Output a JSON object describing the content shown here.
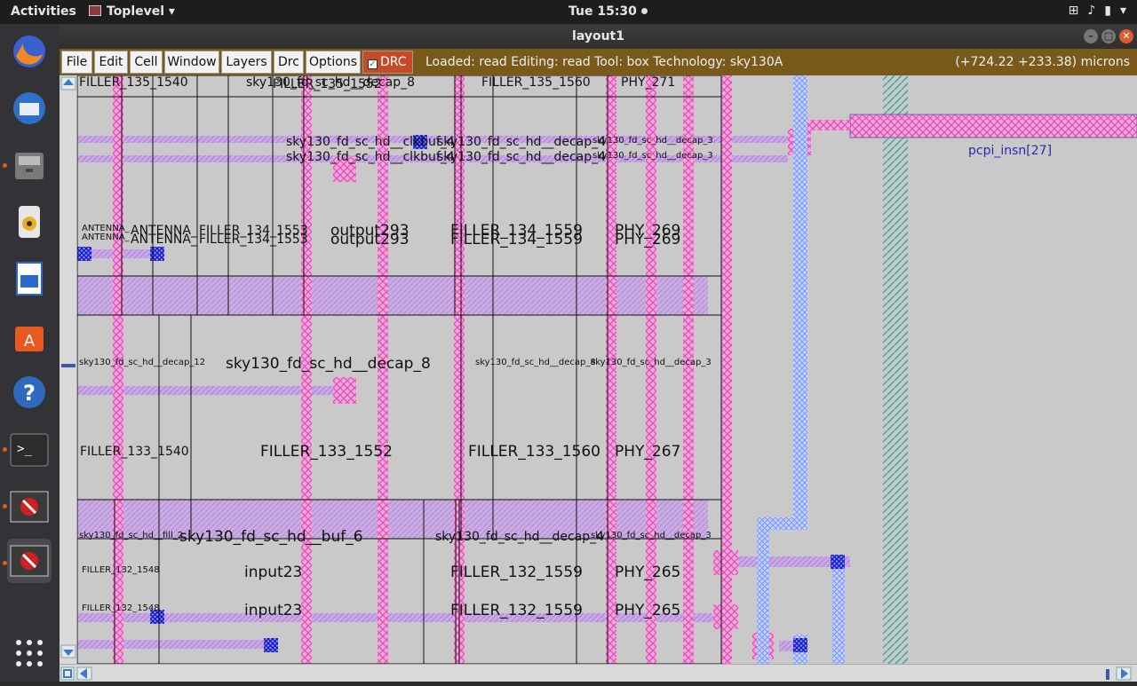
{
  "topbar": {
    "activities": "Activities",
    "app_name": "Toplevel",
    "clock": "Tue 15:30"
  },
  "window": {
    "title": "layout1"
  },
  "menu": {
    "file": "File",
    "edit": "Edit",
    "cell": "Cell",
    "window": "Window",
    "layers": "Layers",
    "drc": "Drc",
    "options": "Options",
    "drc_toggle": "DRC"
  },
  "status": {
    "text": "Loaded: read Editing: read Tool: box  Technology: sky130A",
    "coords": "(+724.22 +233.38) microns"
  },
  "layout": {
    "pin_label": "pcpi_insn[27]",
    "cells": [
      {
        "t": "FILLER_135_1540"
      },
      {
        "t": "sky130_fd_sc_hd__decap_8"
      },
      {
        "t": "FILLER_135_1552"
      },
      {
        "t": "FILLER_135_1560"
      },
      {
        "t": "PHY_271"
      },
      {
        "t": "sky130_fd_sc_hd__clkbuf_4"
      },
      {
        "t": "sky130_fd_sc_hd__decap_4"
      },
      {
        "t": "sky130_fd_sc_hd__decap_3"
      },
      {
        "t": "sky130_fd_sc_hd__clkbuf_4"
      },
      {
        "t": "sky130_fd_sc_hd__decap_4"
      },
      {
        "t": "sky130_fd_sc_hd__decap_3"
      },
      {
        "t": "ANTENNA_"
      },
      {
        "t": "ANTENNA_"
      },
      {
        "t": "FILLER_134_1553"
      },
      {
        "t": "output293"
      },
      {
        "t": "FILLER_134_1559"
      },
      {
        "t": "PHY_269"
      },
      {
        "t": "ANTENNA_"
      },
      {
        "t": "ANTENNA_"
      },
      {
        "t": "FILLER_134_1553"
      },
      {
        "t": "output293"
      },
      {
        "t": "FILLER_134_1559"
      },
      {
        "t": "PHY_269"
      },
      {
        "t": "sky130_fd_sc_hd__decap_12"
      },
      {
        "t": "sky130_fd_sc_hd__decap_8"
      },
      {
        "t": "sky130_fd_sc_hd__decap_8"
      },
      {
        "t": "sky130_fd_sc_hd__decap_3"
      },
      {
        "t": "FILLER_133_1540"
      },
      {
        "t": "FILLER_133_1552"
      },
      {
        "t": "FILLER_133_1560"
      },
      {
        "t": "PHY_267"
      },
      {
        "t": "sky130_fd_sc_hd__fill_2"
      },
      {
        "t": "sky130_fd_sc_hd__buf_6"
      },
      {
        "t": "sky130_fd_sc_hd__decap_4"
      },
      {
        "t": "sky130_fd_sc_hd__decap_3"
      },
      {
        "t": "FILLER_132_1548"
      },
      {
        "t": "input23"
      },
      {
        "t": "FILLER_132_1559"
      },
      {
        "t": "PHY_265"
      },
      {
        "t": "FILLER_132_1548"
      },
      {
        "t": "input23"
      },
      {
        "t": "FILLER_132_1559"
      },
      {
        "t": "PHY_265"
      }
    ]
  },
  "colors": {
    "menubar": "#7a5a1a",
    "drc_button": "#c44a2a",
    "metal1": "#e070c8",
    "metal2": "#9ab0ff",
    "via": "#2020d0",
    "cell_box": "#111111",
    "local_interconnect": "#c8a0e0",
    "nwell": "#40b0a0"
  },
  "icons": {
    "dock": [
      "firefox-icon",
      "thunderbird-icon",
      "files-icon",
      "rhythmbox-icon",
      "writer-icon",
      "software-center-icon",
      "help-icon",
      "terminal-icon",
      "toplevel-app-icon",
      "toplevel-app-icon"
    ]
  }
}
